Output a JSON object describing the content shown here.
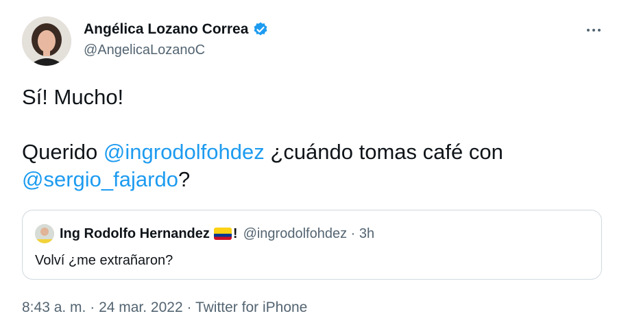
{
  "author": {
    "name": "Angélica Lozano Correa",
    "handle": "@AngelicaLozanoC"
  },
  "tweet": {
    "line1": "Sí! Mucho!",
    "line2_prefix": "Querido ",
    "mention1": "@ingrodolfohdez",
    "line2_suffix": " ¿cuándo tomas café con",
    "mention2": "@sergio_fajardo",
    "line3_suffix": "?"
  },
  "quoted": {
    "name": "Ing Rodolfo Hernandez",
    "name_suffix": "!",
    "meta": "@ingrodolfohdez · 3h",
    "text": "Volví ¿me extrañaron?"
  },
  "footer": {
    "time": "8:43 a. m.",
    "sep1": " · ",
    "date": "24 mar. 2022",
    "sep2": " · ",
    "source": "Twitter for iPhone"
  },
  "colors": {
    "accent": "#1d9bf0",
    "text": "#0f1419",
    "secondary": "#536471",
    "border": "#cfd9de"
  },
  "icons": {
    "verified": "verified-badge-icon",
    "more": "more-icon",
    "flag": "colombia-flag-icon"
  }
}
